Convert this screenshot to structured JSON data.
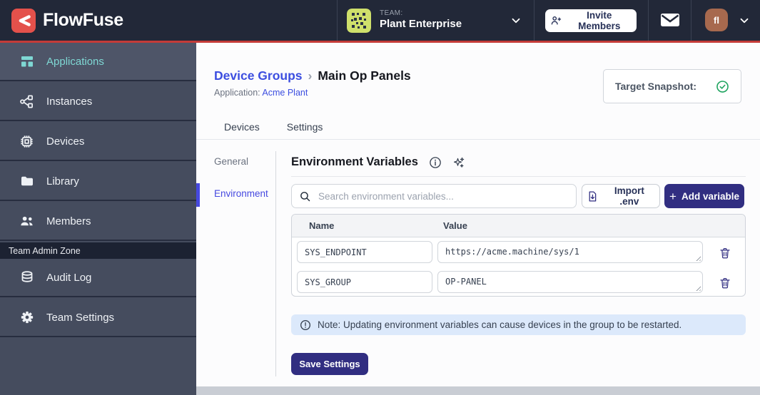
{
  "colors": {
    "brand_red": "#e4514b",
    "accent_line_red": "#c43b38",
    "topbar_bg": "#222838",
    "sidebar_bg": "#454c5e",
    "sidebar_active_teal": "#7fd8d4",
    "primary_indigo": "#312e81",
    "link_blue": "#3c4ee0",
    "subnav_active_blue": "#4649e0",
    "note_banner_bg": "#dce9fb",
    "success_green": "#1da35e",
    "identicon_green": "#cfe06b"
  },
  "topbar": {
    "brand": "FlowFuse",
    "team_label": "TEAM:",
    "team_name": "Plant Enterprise",
    "invite_button_label": "Invite Members",
    "avatar_initials": "fl"
  },
  "sidebar": {
    "items": [
      {
        "label": "Applications",
        "icon": "applications-icon",
        "active": true
      },
      {
        "label": "Instances",
        "icon": "instances-icon",
        "active": false
      },
      {
        "label": "Devices",
        "icon": "devices-icon",
        "active": false
      },
      {
        "label": "Library",
        "icon": "library-icon",
        "active": false
      },
      {
        "label": "Members",
        "icon": "members-icon",
        "active": false
      }
    ],
    "admin_zone_label": "Team Admin Zone",
    "admin_items": [
      {
        "label": "Audit Log",
        "icon": "audit-log-icon"
      },
      {
        "label": "Team Settings",
        "icon": "team-settings-icon"
      }
    ]
  },
  "page": {
    "breadcrumb": {
      "parent": "Device Groups",
      "separator": "›",
      "current": "Main Op Panels"
    },
    "application_label": "Application:",
    "application_name": "Acme Plant",
    "target_snapshot_label": "Target Snapshot:",
    "tabs": [
      {
        "label": "Devices"
      },
      {
        "label": "Settings"
      }
    ]
  },
  "settings": {
    "subnav": [
      {
        "label": "General",
        "active": false
      },
      {
        "label": "Environment",
        "active": true
      }
    ],
    "env": {
      "title": "Environment Variables",
      "search_placeholder": "Search environment variables...",
      "import_button_label": "Import .env",
      "add_button_label": "Add variable",
      "table": {
        "columns": [
          "Name",
          "Value"
        ],
        "rows": [
          {
            "name": "SYS_ENDPOINT",
            "value": "https://acme.machine/sys/1"
          },
          {
            "name": "SYS_GROUP",
            "value": "OP-PANEL"
          }
        ]
      },
      "note": "Note: Updating environment variables can cause devices in the group to be restarted.",
      "save_button_label": "Save Settings"
    }
  }
}
